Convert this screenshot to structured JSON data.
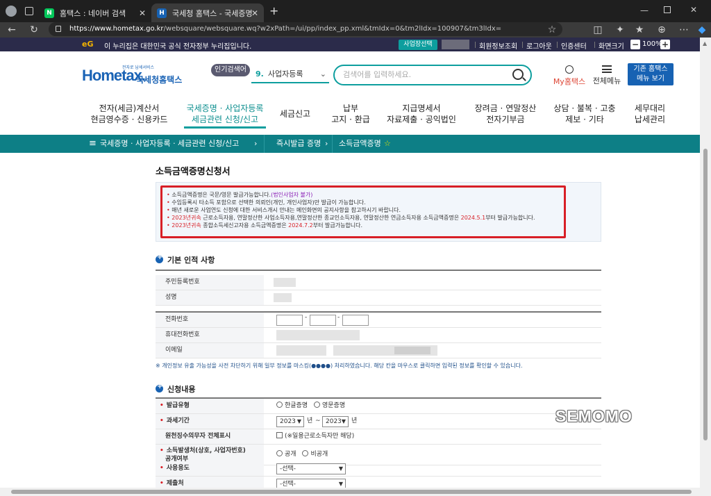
{
  "browser": {
    "tabs": [
      {
        "label": "홈택스 : 네이버 검색",
        "favicon": "N"
      },
      {
        "label": "국세청 홈택스 - 국세증명 · 사업자",
        "favicon": "H"
      }
    ],
    "new_tab": "+",
    "url_domain": "https://www.hometax.go.kr",
    "url_path": "/websquare/websquare.wq?w2xPath=/ui/pp/index_pp.xml&tmIdx=0&tm2lIdx=100907&tm3lIdx="
  },
  "govbar": {
    "logo": "eG",
    "text": "이 누리집은 대한민국 공식 전자정부 누리집입니다.",
    "biz_button": "사업장선택",
    "links": [
      "회원정보조회",
      "로그아웃",
      "인증센터",
      "화면크기"
    ],
    "zoom_minus": "−",
    "zoom": "100%",
    "zoom_plus": "+"
  },
  "header": {
    "logo_text": "Hometax.",
    "logo_kr": "국세청홈택스",
    "logo_tiny": "전자로 납세서비스",
    "popular_badge": "인기검색어",
    "popular_rank": "9.",
    "popular_term": "사업자등록",
    "search_placeholder": "검색어를 입력하세요.",
    "my_hometax": "My홈택스",
    "all_menu": "전체메뉴",
    "old_menu_1": "기존 홈택스",
    "old_menu_2": "메뉴 보기"
  },
  "gnb": [
    {
      "l1": "전자(세금)계산서",
      "l2": "현금영수증 · 신용카드"
    },
    {
      "l1": "국세증명 · 사업자등록",
      "l2": "세금관련 신청/신고"
    },
    {
      "l1": "세금신고",
      "l2": ""
    },
    {
      "l1": "납부",
      "l2": "고지 · 환급"
    },
    {
      "l1": "지급명세서",
      "l2": "자료제출 · 공익법인"
    },
    {
      "l1": "장려금 · 연말정산",
      "l2": "전자기부금"
    },
    {
      "l1": "상담 · 불복 · 고충",
      "l2": "제보 · 기타"
    },
    {
      "l1": "세무대리",
      "l2": "납세관리"
    }
  ],
  "breadcrumb": {
    "menu": "≡",
    "items": [
      "국세증명 · 사업자등록 · 세금관련 신청/신고",
      "즉시발급 증명",
      "소득금액증명"
    ],
    "star": "☆"
  },
  "page": {
    "title": "소득금액증명신청서",
    "notice": {
      "l1_a": "소득금액증명은 국문/영문 발급가능합니다.",
      "l1_b": "(법인사업자 불가)",
      "l2": "수임등록시 타소득 포함으로 선택한 의뢰인(개인, 개인사업자)만 발급이 가능합니다.",
      "l3": "매년 새로운 사업연도 신청에 대한 서비스개시 안내는 메인화면의 공지사항을 참고하시기 바랍니다.",
      "l4_a": "2023년귀속",
      "l4_b": " 근로소득자용, 연말정산한 사업소득자용,연말정산한 종교인소득자용, 연말정산한 연금소득자용 소득금액증명은 ",
      "l4_c": "2024.5.1",
      "l4_d": "부터 발급가능합니다.",
      "l5_a": "2023년귀속",
      "l5_b": " 종합소득세신고자용 소득금액증명은 ",
      "l5_c": "2024.7.2",
      "l5_d": "부터 발급가능합니다."
    },
    "basic_title": "기본 인적 사항",
    "basic_rows": [
      "주민등록번호",
      "성명"
    ],
    "contact_rows": [
      "전화번호",
      "휴대전화번호",
      "이메일"
    ],
    "dash": "-",
    "privacy_note": "※ 개인정보 유출 가능성을 사전 차단하기 위해 일부 정보를 마스킹(●●●●) 처리하였습니다. 해당 칸을 마우스로 클릭하면 입력된 정보를 확인할 수 있습니다.",
    "apply_title": "신청내용",
    "req_mark": "•",
    "apply": {
      "issue_type_label": "발급유형",
      "issue_kr": "한글증명",
      "issue_en": "영문증명",
      "period_label": "과세기간",
      "year_from": "2023",
      "year_to": "2023",
      "year_unit": "년",
      "tilde": "~",
      "withholding_label": "원천징수의무자 전체표시",
      "withholding_opt": "(※일용근로소득자만 해당)",
      "source_label_1": "소득발생처(상호, 사업자번호)",
      "source_label_2": "공개여부",
      "public": "공개",
      "private": "비공개",
      "usage_label": "사용용도",
      "usage_value": "-선택-",
      "submit_label": "제출처",
      "submit_value": "-선택-"
    }
  },
  "watermark": "SEMOMO",
  "colors": {
    "teal": "#0d9e9e",
    "blue": "#1762b3",
    "red": "#d81f26",
    "gov": "#2b2b4a"
  }
}
